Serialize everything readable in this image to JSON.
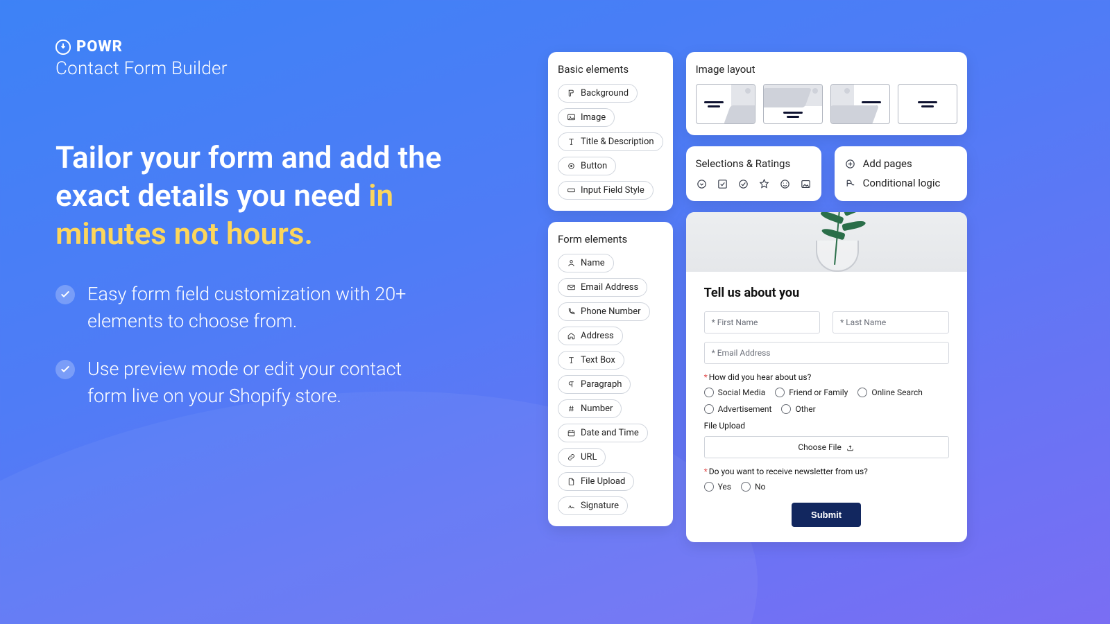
{
  "brand": "POWR",
  "product": "Contact Form Builder",
  "headline_a": "Tailor your form and add the exact details you need ",
  "headline_b": "in minutes not hours.",
  "bullets": [
    "Easy form field customization with 20+ elements to choose from.",
    "Use preview mode or edit your contact form live on your Shopify store."
  ],
  "basic": {
    "title": "Basic elements",
    "items": [
      "Background",
      "Image",
      "Title & Description",
      "Button",
      "Input Field Style"
    ]
  },
  "form_elements": {
    "title": "Form elements",
    "items": [
      "Name",
      "Email Address",
      "Phone Number",
      "Address",
      "Text Box",
      "Paragraph",
      "Number",
      "Date and Time",
      "URL",
      "File Upload",
      "Signature"
    ]
  },
  "image_layout_title": "Image layout",
  "selections_title": "Selections & Ratings",
  "features": {
    "add_pages": "Add pages",
    "conditional": "Conditional logic"
  },
  "preview": {
    "title": "Tell us about you",
    "first_name": "* First Name",
    "last_name": "* Last Name",
    "email": "* Email Address",
    "q1": "How did you hear about us?",
    "q1_opts": [
      "Social Media",
      "Friend or Family",
      "Online Search",
      "Advertisement",
      "Other"
    ],
    "upload_label": "File Upload",
    "choose_file": "Choose File",
    "q2": "Do you want to receive newsletter from us?",
    "q2_opts": [
      "Yes",
      "No"
    ],
    "submit": "Submit"
  }
}
